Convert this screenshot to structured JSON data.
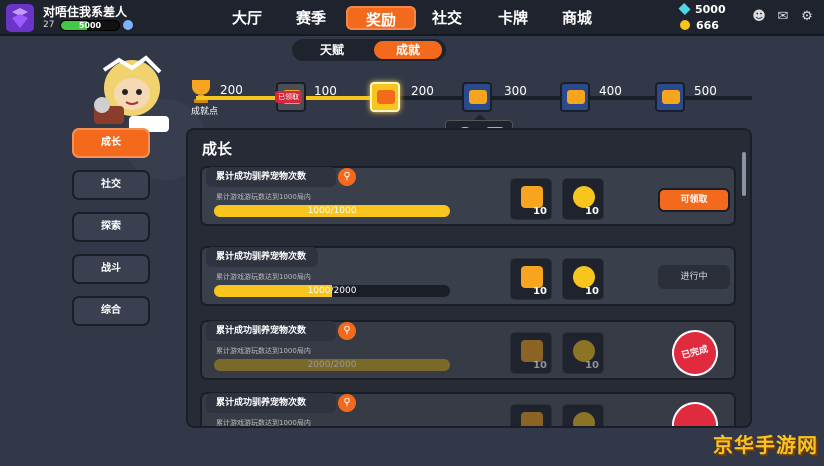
{
  "player": {
    "name": "对唔住我系差人",
    "level": "27",
    "xp_text": "5000",
    "xp_fraction": 0.45
  },
  "nav": {
    "tabs": [
      {
        "label": "大厅"
      },
      {
        "label": "赛季"
      },
      {
        "label": "奖励"
      },
      {
        "label": "社交"
      },
      {
        "label": "卡牌"
      },
      {
        "label": "商城"
      }
    ],
    "active": "奖励"
  },
  "currency": {
    "gems": "5000",
    "coins": "666"
  },
  "subtabs": {
    "items": [
      "天赋",
      "成就"
    ],
    "active": "成就"
  },
  "track": {
    "start_value": "200",
    "label": "成就点",
    "badge": "已领取",
    "milestones": [
      "100",
      "200",
      "300",
      "400",
      "500"
    ],
    "tooltip": {
      "coins": "100",
      "points": "2"
    }
  },
  "left_menu": [
    "成长",
    "社交",
    "探索",
    "战斗",
    "综合"
  ],
  "left_active": "成长",
  "panel": {
    "title": "成长",
    "cards": [
      {
        "title": "累计成功驯养宠物次数",
        "desc": "累计游戏游玩数达到1000局内",
        "progress_text": "1000/1000",
        "progress": 1.0,
        "reward1": "10",
        "reward2": "10",
        "status": "可领取"
      },
      {
        "title": "累计成功驯养宠物次数",
        "desc": "累计游戏游玩数达到1000局内",
        "progress_text": "1000/2000",
        "progress": 0.5,
        "reward1": "10",
        "reward2": "10",
        "status": "进行中"
      },
      {
        "title": "累计成功驯养宠物次数",
        "desc": "累计游戏游玩数达到1000局内",
        "progress_text": "2000/2000",
        "progress": 1.0,
        "reward1": "10",
        "reward2": "10",
        "status": "已完成"
      },
      {
        "title": "累计成功驯养宠物次数",
        "desc": "累计游戏游玩数达到1000局内",
        "progress_text": "",
        "progress": 0,
        "reward1": "10",
        "reward2": "10",
        "status": ""
      }
    ]
  },
  "watermark": "京华手游网",
  "colors": {
    "accent": "#f36a1d",
    "gold": "#f7c51e",
    "bg": "#323847"
  }
}
